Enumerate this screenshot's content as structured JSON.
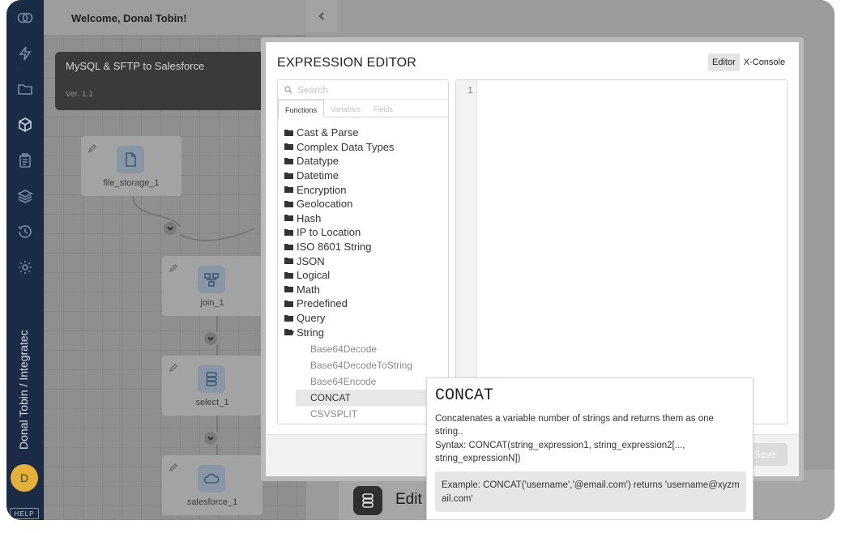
{
  "header": {
    "welcome": "Welcome, Donal Tobin!"
  },
  "sidebar": {
    "breadcrumb": "Donal Tobin / Integratec",
    "avatar_initial": "D",
    "help_label": "HELP"
  },
  "flow": {
    "title": "MySQL & SFTP to Salesforce",
    "version": "Ver. 1.1"
  },
  "nodes": [
    {
      "label": "file_storage_1"
    },
    {
      "label": "join_1"
    },
    {
      "label": "select_1"
    },
    {
      "label": "salesforce_1"
    }
  ],
  "bottom_panel": {
    "edit_label": "Edit"
  },
  "modal": {
    "title": "EXPRESSION EDITOR",
    "modes": [
      "Editor",
      "X-Console"
    ],
    "search_placeholder": "Search",
    "tabs": [
      "Functions",
      "Variables",
      "Fields"
    ],
    "folders": [
      "Cast & Parse",
      "Complex Data Types",
      "Datatype",
      "Datetime",
      "Encryption",
      "Geolocation",
      "Hash",
      "IP to Location",
      "ISO 8601 String",
      "JSON",
      "Logical",
      "Math",
      "Predefined",
      "Query",
      "String"
    ],
    "string_functions": [
      "Base64Decode",
      "Base64DecodeToString",
      "Base64Encode",
      "CONCAT",
      "CSVSPLIT"
    ],
    "selected_function": "CONCAT",
    "editor_line_number": "1",
    "save_label": "Save"
  },
  "tooltip": {
    "title": "CONCAT",
    "description": "Concatenates a variable number of strings and returns them as one string..",
    "syntax": "Syntax: CONCAT(string_expression1, string_expression2[..., string_expressionN])",
    "example": "Example: CONCAT('username','@email.com') returns 'username@xyzmail.com'"
  }
}
